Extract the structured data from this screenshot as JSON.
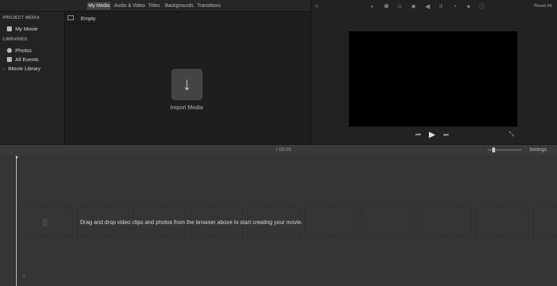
{
  "tabs": [
    "My Media",
    "Audio & Video",
    "Titles",
    "Backgrounds",
    "Transitions"
  ],
  "sidebar": {
    "project_header": "PROJECT MEDIA",
    "project_item": "My Movie",
    "libraries_header": "LIBRARIES",
    "library_items": [
      "Photos",
      "All Events"
    ],
    "library": "iMovie Library"
  },
  "browser": {
    "filter": "Empty",
    "import_label": "Import Media"
  },
  "viewer": {
    "reset_all": "Reset All"
  },
  "timeline": {
    "timecode": "/ 00:00",
    "settings": "Settings",
    "hint": "Drag and drop video clips and photos from the browser above to start creating your movie."
  }
}
